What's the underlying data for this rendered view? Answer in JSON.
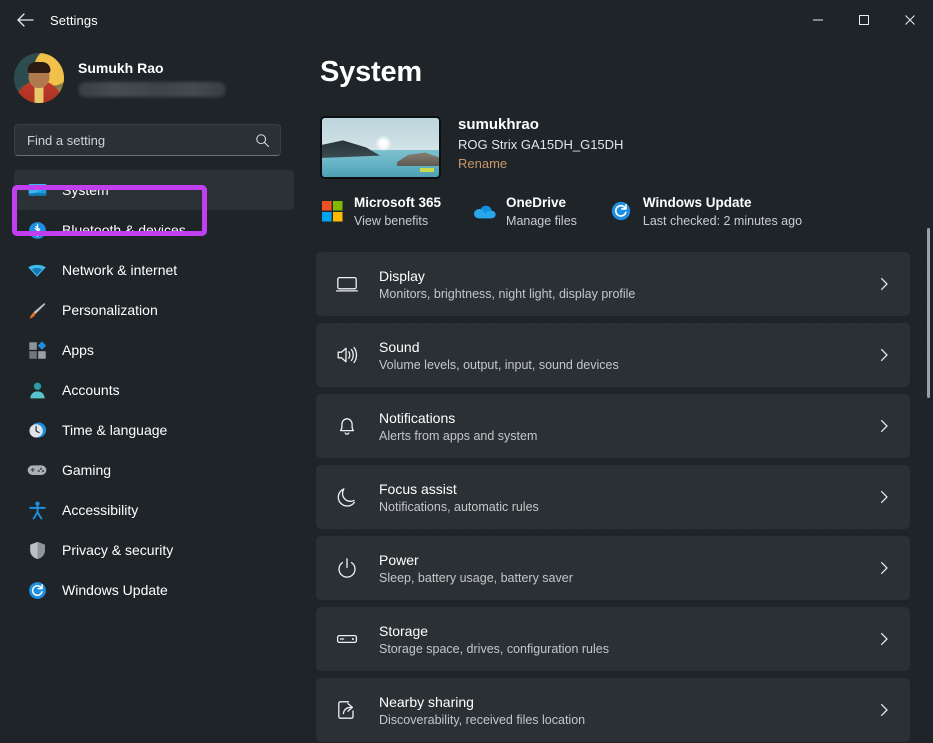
{
  "window": {
    "title": "Settings",
    "back_icon": "back-arrow-icon",
    "minimize_label": "—",
    "maximize_label": "□",
    "close_label": "✕"
  },
  "account": {
    "name": "Sumukh Rao",
    "email_hidden": "",
    "avatar_alt": "user-avatar"
  },
  "search": {
    "placeholder": "Find a setting",
    "value": "",
    "icon": "search-icon"
  },
  "sidebar": {
    "items": [
      {
        "label": "System",
        "icon": "monitor-icon",
        "selected": true
      },
      {
        "label": "Bluetooth & devices",
        "icon": "bluetooth-icon",
        "selected": false
      },
      {
        "label": "Network & internet",
        "icon": "wifi-icon",
        "selected": false
      },
      {
        "label": "Personalization",
        "icon": "paintbrush-icon",
        "selected": false
      },
      {
        "label": "Apps",
        "icon": "apps-grid-icon",
        "selected": false
      },
      {
        "label": "Accounts",
        "icon": "person-icon",
        "selected": false
      },
      {
        "label": "Time & language",
        "icon": "clock-icon",
        "selected": false
      },
      {
        "label": "Gaming",
        "icon": "gamepad-icon",
        "selected": false
      },
      {
        "label": "Accessibility",
        "icon": "accessibility-person-icon",
        "selected": false
      },
      {
        "label": "Privacy & security",
        "icon": "shield-icon",
        "selected": false
      },
      {
        "label": "Windows Update",
        "icon": "refresh-circle-icon",
        "selected": false
      }
    ]
  },
  "main": {
    "page_title": "System",
    "device": {
      "name": "sumukhrao",
      "model": "ROG Strix GA15DH_G15DH",
      "rename_label": "Rename",
      "thumbnail_alt": "desktop-wallpaper-thumbnail"
    },
    "quick_links": [
      {
        "title": "Microsoft 365",
        "subtitle": "View benefits",
        "icon": "microsoft-logo-icon"
      },
      {
        "title": "OneDrive",
        "subtitle": "Manage files",
        "icon": "onedrive-cloud-icon"
      },
      {
        "title": "Windows Update",
        "subtitle": "Last checked: 2 minutes ago",
        "icon": "refresh-circle-icon"
      }
    ],
    "settings_rows": [
      {
        "title": "Display",
        "subtitle": "Monitors, brightness, night light, display profile",
        "icon": "monitor-outline-icon"
      },
      {
        "title": "Sound",
        "subtitle": "Volume levels, output, input, sound devices",
        "icon": "speaker-icon"
      },
      {
        "title": "Notifications",
        "subtitle": "Alerts from apps and system",
        "icon": "bell-icon"
      },
      {
        "title": "Focus assist",
        "subtitle": "Notifications, automatic rules",
        "icon": "moon-icon"
      },
      {
        "title": "Power",
        "subtitle": "Sleep, battery usage, battery saver",
        "icon": "power-icon"
      },
      {
        "title": "Storage",
        "subtitle": "Storage space, drives, configuration rules",
        "icon": "drive-icon"
      },
      {
        "title": "Nearby sharing",
        "subtitle": "Discoverability, received files location",
        "icon": "share-icon"
      }
    ]
  },
  "annotation": {
    "target": "System",
    "color": "#c13ff0"
  },
  "colors": {
    "window_background": "#1f2428",
    "card_background": "#2b3034",
    "accent_rename": "#c8996a",
    "annotation": "#c13ff0",
    "selected_nav": "#2c3135"
  }
}
